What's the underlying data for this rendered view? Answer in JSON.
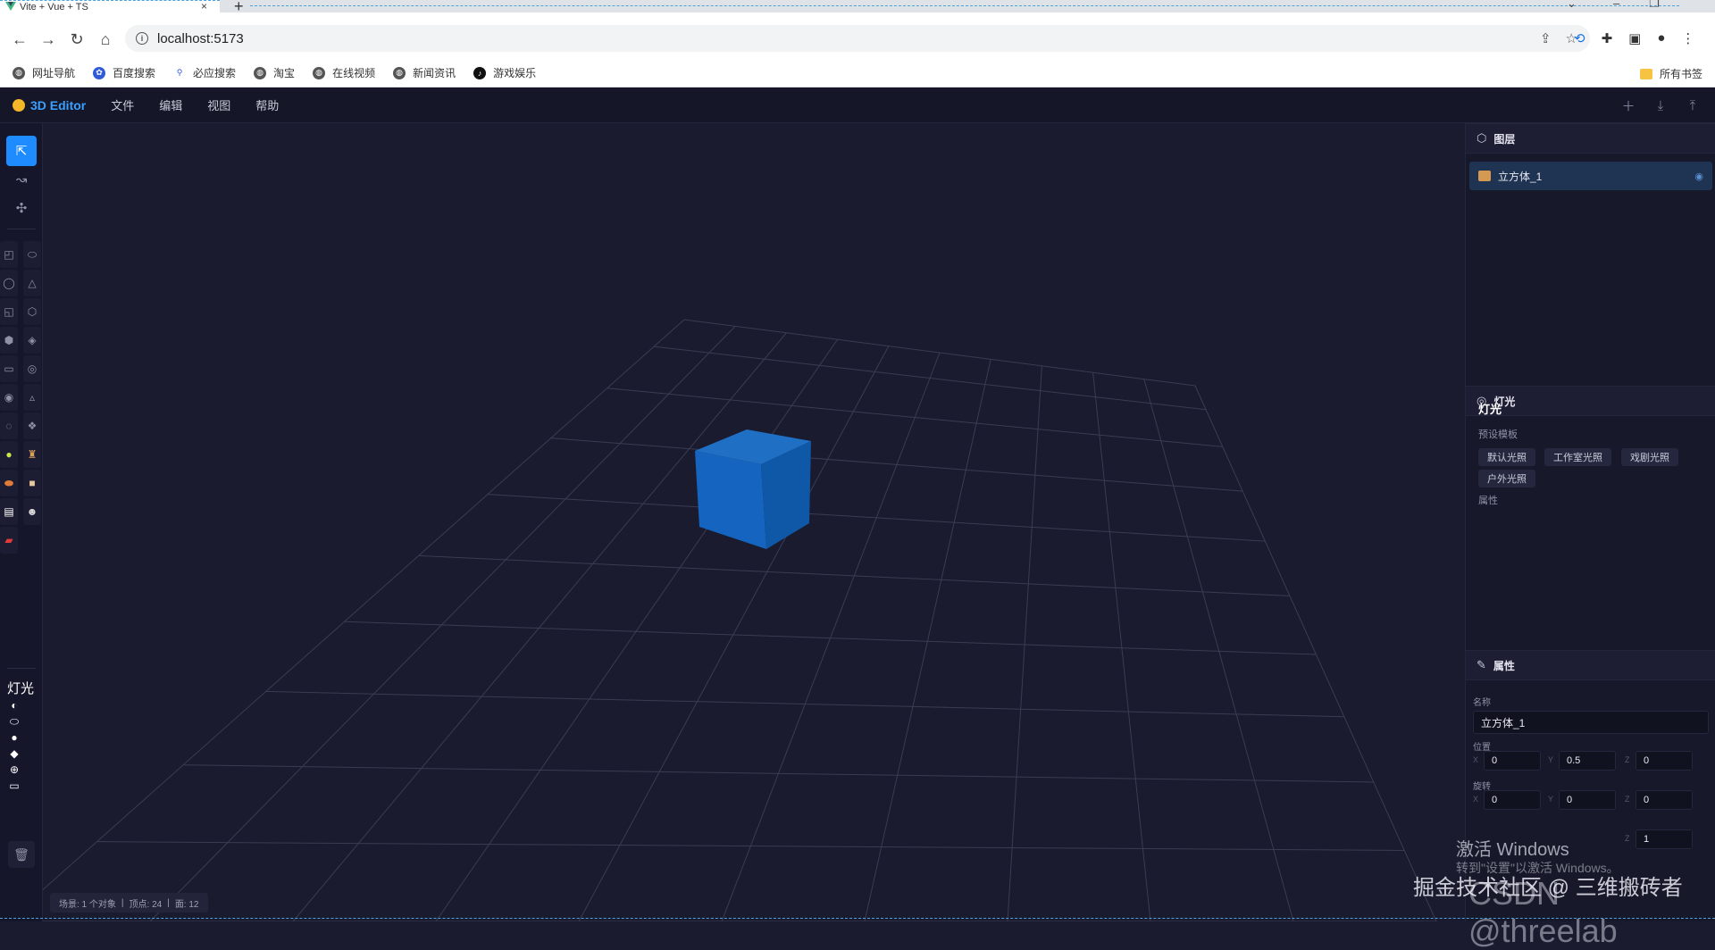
{
  "browser": {
    "tab_title": "Vite + Vue + TS",
    "tab_close": "×",
    "new_tab": "+",
    "url": "localhost:5173",
    "bookmarks": [
      "网址导航",
      "百度搜索",
      "必应搜索",
      "淘宝",
      "在线视频",
      "新闻资讯",
      "游戏娱乐"
    ],
    "all_bookmarks": "所有书签"
  },
  "app": {
    "brand": "3D Editor",
    "menu": [
      "文件",
      "编辑",
      "视图",
      "帮助"
    ]
  },
  "toolbar": {
    "lights_title": "灯光"
  },
  "viewport": {
    "status": [
      "场景: 1 个对象",
      "|",
      "顶点: 24",
      "|",
      "面: 12"
    ],
    "object_color": "#1565c0",
    "grid_color": "#3a3c52"
  },
  "panel": {
    "layers_title": "图层",
    "layer_items": [
      "立方体_1"
    ],
    "lights_header": "灯光",
    "lights_title": "灯光",
    "preset_label": "预设模板",
    "presets": [
      "默认光照",
      "工作室光照",
      "戏剧光照",
      "户外光照"
    ],
    "attr_label": "属性",
    "props_title": "属性",
    "name_label": "名称",
    "name_value": "立方体_1",
    "position_label": "位置",
    "position": {
      "x": "0",
      "y": "0.5",
      "z": "0"
    },
    "rotation_label": "旋转",
    "rotation": {
      "x": "0",
      "y": "0",
      "z": "0"
    },
    "scale_partial": {
      "z": "1"
    },
    "axis_x": "X",
    "axis_y": "Y",
    "axis_z": "Z"
  },
  "overlay": {
    "activate_title": "激活 Windows",
    "activate_sub": "转到\"设置\"以激活 Windows。",
    "juejin": "掘金技术社区 @ 三维搬砖者",
    "csdn": "CSDN @threelab"
  }
}
